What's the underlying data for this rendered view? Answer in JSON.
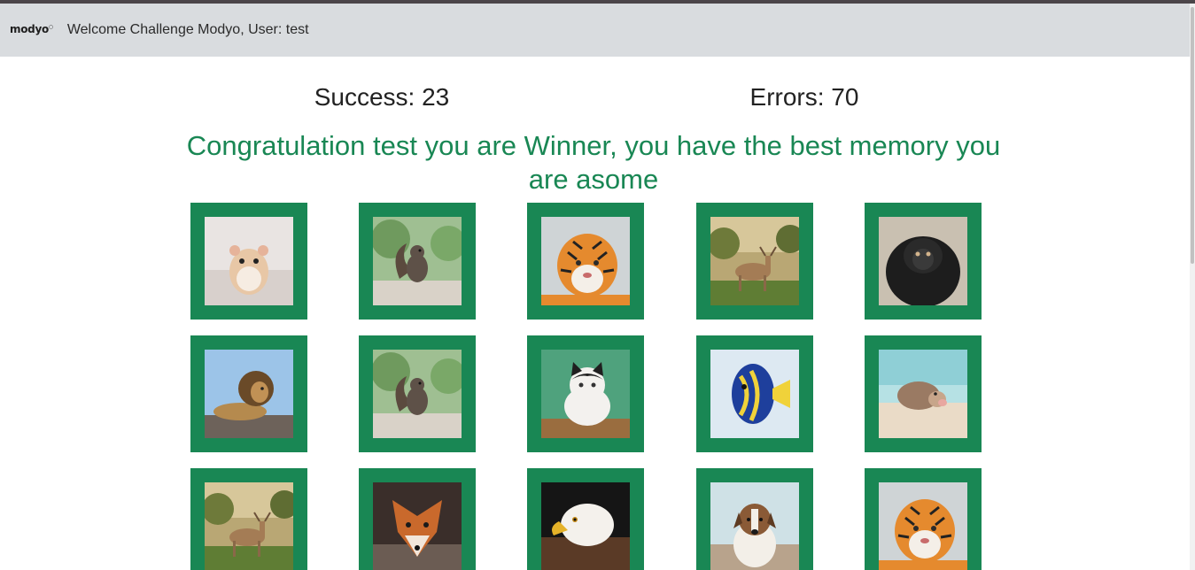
{
  "navbar": {
    "logo": "modyo",
    "title": "Welcome Challenge Modyo, User: test"
  },
  "score": {
    "success": "Success: 23",
    "errors": "Errors: 70"
  },
  "message": "Congratulation test you are Winner, you have the best memory you are asome",
  "colors": {
    "card": "#198754",
    "message": "#198754",
    "navbar": "#d9dcdf"
  },
  "cards": [
    {
      "animal": "hamster"
    },
    {
      "animal": "squirrel"
    },
    {
      "animal": "tiger"
    },
    {
      "animal": "deer"
    },
    {
      "animal": "monkey"
    },
    {
      "animal": "lion"
    },
    {
      "animal": "squirrel"
    },
    {
      "animal": "cat"
    },
    {
      "animal": "fish"
    },
    {
      "animal": "pig"
    },
    {
      "animal": "deer"
    },
    {
      "animal": "fox"
    },
    {
      "animal": "eagle"
    },
    {
      "animal": "dog"
    },
    {
      "animal": "tiger"
    }
  ]
}
